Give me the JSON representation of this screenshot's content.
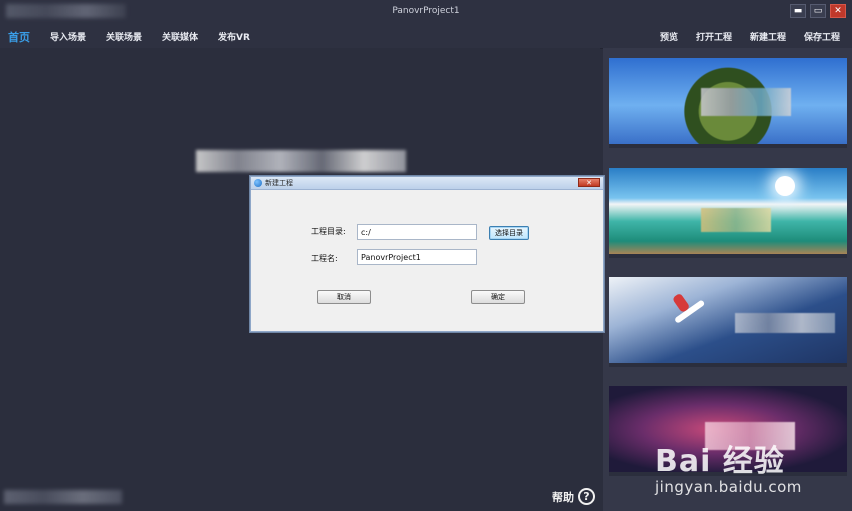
{
  "window": {
    "title": "PanovrProject1",
    "controls": {
      "minimize": "▬",
      "maximize": "▭",
      "close": "✕"
    }
  },
  "menu": {
    "left": [
      {
        "label": "首页",
        "active": true
      },
      {
        "label": "导入场景",
        "active": false
      },
      {
        "label": "关联场景",
        "active": false
      },
      {
        "label": "关联媒体",
        "active": false
      },
      {
        "label": "发布VR",
        "active": false
      }
    ],
    "right": [
      {
        "label": "预览"
      },
      {
        "label": "打开工程"
      },
      {
        "label": "新建工程"
      },
      {
        "label": "保存工程"
      }
    ]
  },
  "help": {
    "label": "帮助",
    "icon_glyph": "?"
  },
  "thumbnails": [
    {
      "icon": "planet-panorama-thumbnail"
    },
    {
      "icon": "beach-panorama-thumbnail"
    },
    {
      "icon": "snowboard-panorama-thumbnail"
    },
    {
      "icon": "nebula-panorama-thumbnail"
    }
  ],
  "dialog": {
    "title": "新建工程",
    "close_glyph": "✕",
    "dir_label": "工程目录:",
    "dir_value": "c:/",
    "choose_dir_label": "选择目录",
    "name_label": "工程名:",
    "name_value": "PanovrProject1",
    "cancel_label": "取消",
    "ok_label": "确定"
  },
  "watermark": {
    "logo": "Bai 经验",
    "site": "jingyan.baidu.com"
  },
  "colors": {
    "accent": "#3a9de6",
    "background": "#2b2e3d",
    "panel": "#353849",
    "close_red": "#c13a22"
  }
}
